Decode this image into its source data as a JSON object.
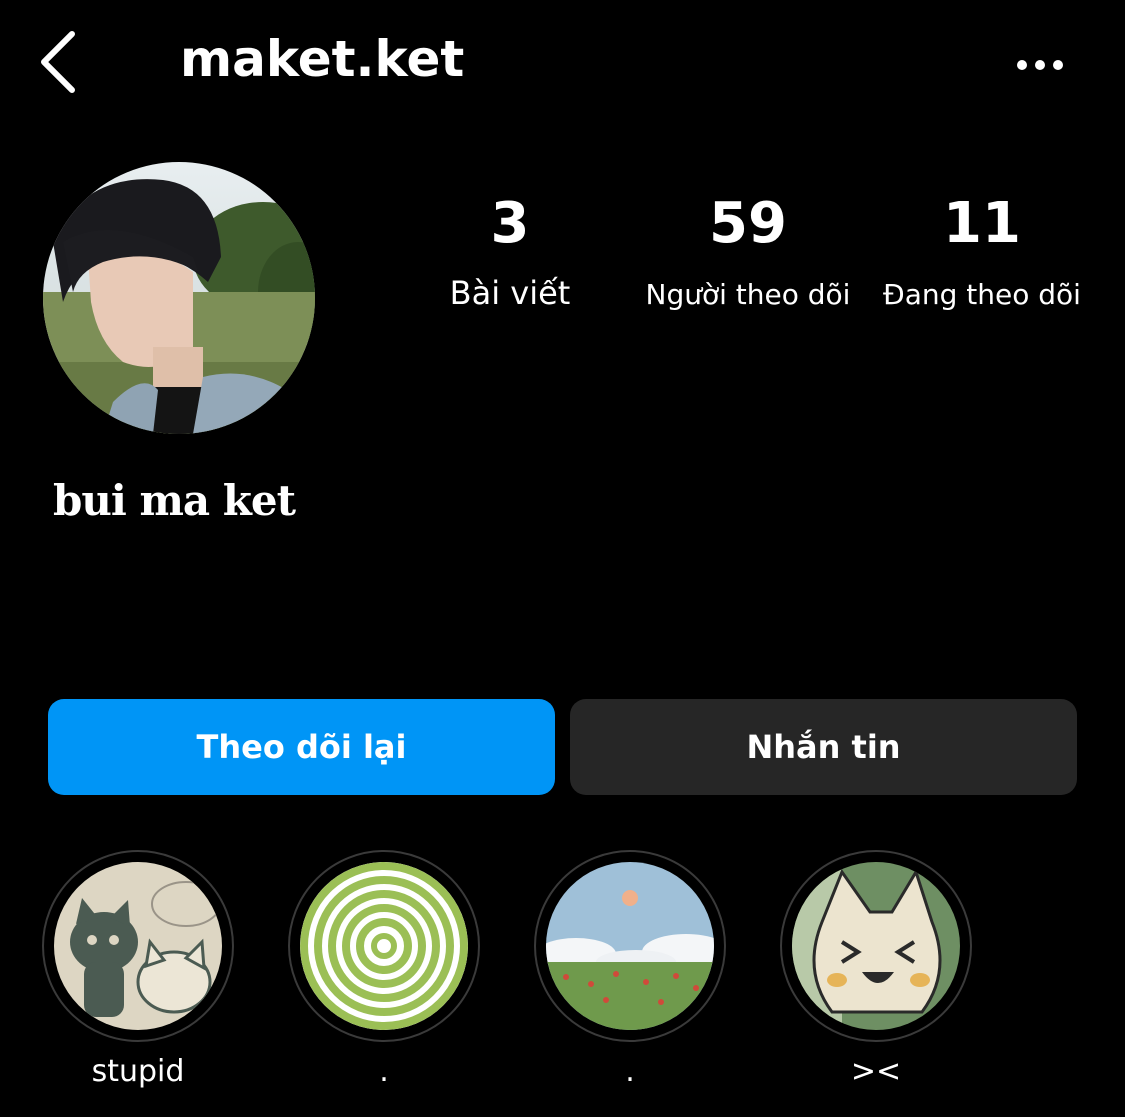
{
  "header": {
    "username": "maket.ket",
    "back_icon": "chevron-left-icon",
    "more_icon": "more-horizontal-icon"
  },
  "profile": {
    "display_name": "bui ma ket",
    "stats": [
      {
        "value": "3",
        "label": "Bài viết"
      },
      {
        "value": "59",
        "label": "Người theo dõi"
      },
      {
        "value": "11",
        "label": "Đang theo dõi"
      }
    ]
  },
  "actions": {
    "follow_back_label": "Theo dõi lại",
    "message_label": "Nhắn tin"
  },
  "highlights": [
    {
      "label": "stupid"
    },
    {
      "label": "."
    },
    {
      "label": "."
    },
    {
      "label": "><"
    }
  ],
  "colors": {
    "background": "#000000",
    "primary_button": "#0095f6",
    "secondary_button": "#262626"
  }
}
